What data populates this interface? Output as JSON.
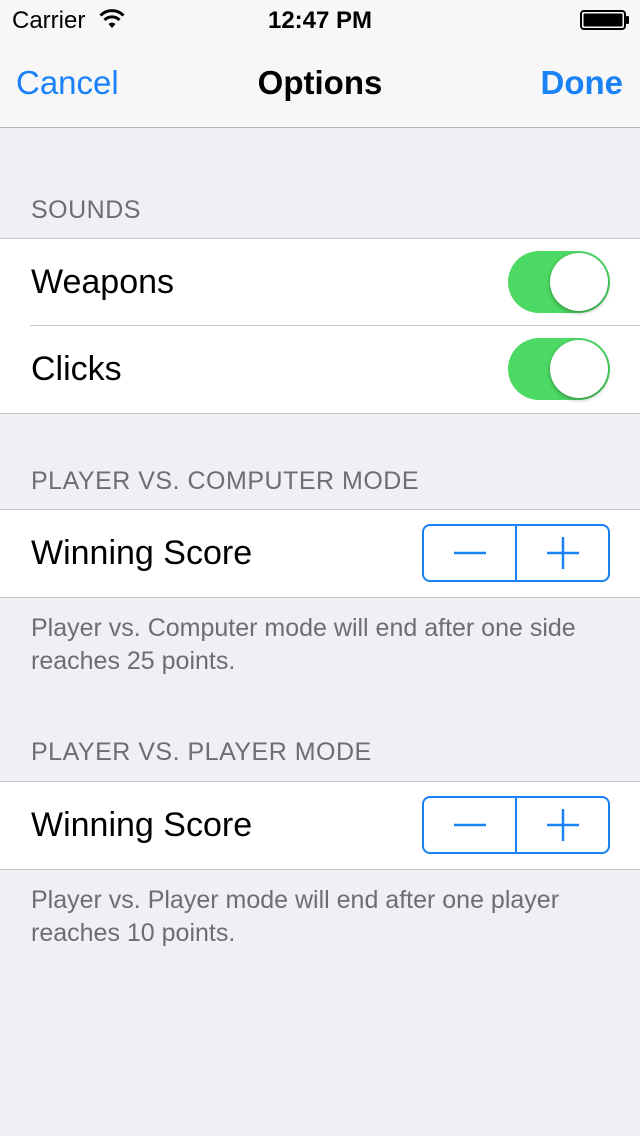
{
  "status_bar": {
    "carrier": "Carrier",
    "time": "12:47 PM"
  },
  "nav": {
    "cancel": "Cancel",
    "title": "Options",
    "done": "Done"
  },
  "sounds": {
    "header": "SOUNDS",
    "items": [
      {
        "label": "Weapons",
        "on": true
      },
      {
        "label": "Clicks",
        "on": true
      }
    ]
  },
  "pvc": {
    "header": "PLAYER VS. COMPUTER MODE",
    "label": "Winning Score",
    "footer": "Player vs. Computer mode will end after one side reaches 25 points."
  },
  "pvp": {
    "header": "PLAYER VS. PLAYER MODE",
    "label": "Winning Score",
    "footer": "Player vs. Player mode will end after one player reaches 10 points."
  },
  "colors": {
    "accent": "#1a82f6",
    "toggle_on": "#4cd964",
    "background": "#efeff4"
  }
}
